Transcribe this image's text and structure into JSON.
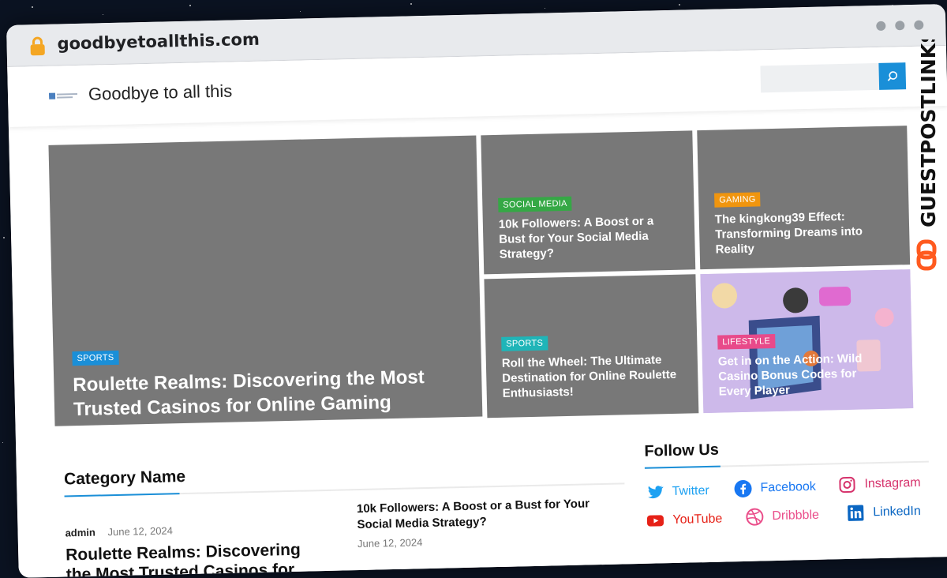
{
  "browser": {
    "url": "goodbyetoallthis.com"
  },
  "site": {
    "title": "Goodbye to all this",
    "search_placeholder": ""
  },
  "featured": {
    "main": {
      "category": "SPORTS",
      "category_color": "#1a8fd8",
      "title": "Roulette Realms: Discovering the Most Trusted Casinos for Online Gaming"
    },
    "top_mid": {
      "category": "SOCIAL MEDIA",
      "category_color": "#35a845",
      "title": "10k Followers: A Boost or a Bust for Your Social Media Strategy?"
    },
    "top_right": {
      "category": "GAMING",
      "category_color": "#f0950e",
      "title": "The kingkong39 Effect: Transforming Dreams into Reality"
    },
    "bottom_mid": {
      "category": "SPORTS",
      "category_color": "#1fb5b8",
      "title": "Roll the Wheel: The Ultimate Destination for Online Roulette Enthusiasts!"
    },
    "bottom_right": {
      "category": "LIFESTYLE",
      "category_color": "#e84a8a",
      "title": "Get in on the Action: Wild Casino Bonus Codes for Every Player"
    }
  },
  "category_section": {
    "heading": "Category Name",
    "big_post": {
      "author": "admin",
      "date": "June 12, 2024",
      "title": "Roulette Realms: Discovering the Most Trusted Casinos for Online Gaming"
    },
    "small_post": {
      "title": "10k Followers: A Boost or a Bust for Your Social Media Strategy?",
      "date": "June 12, 2024"
    }
  },
  "follow": {
    "heading": "Follow Us",
    "links": [
      {
        "label": "Twitter",
        "icon": "twitter-icon",
        "color": "#1da1f2"
      },
      {
        "label": "Facebook",
        "icon": "facebook-icon",
        "color": "#1877f2"
      },
      {
        "label": "Instagram",
        "icon": "instagram-icon",
        "color": "#d6336c"
      },
      {
        "label": "YouTube",
        "icon": "youtube-icon",
        "color": "#e62117"
      },
      {
        "label": "Dribbble",
        "icon": "dribbble-icon",
        "color": "#ea4c89"
      },
      {
        "label": "LinkedIn",
        "icon": "linkedin-icon",
        "color": "#0a66c2"
      }
    ]
  },
  "watermark": {
    "text": "GUESTPOSTLINKS",
    "color": "#ff5a1f"
  }
}
